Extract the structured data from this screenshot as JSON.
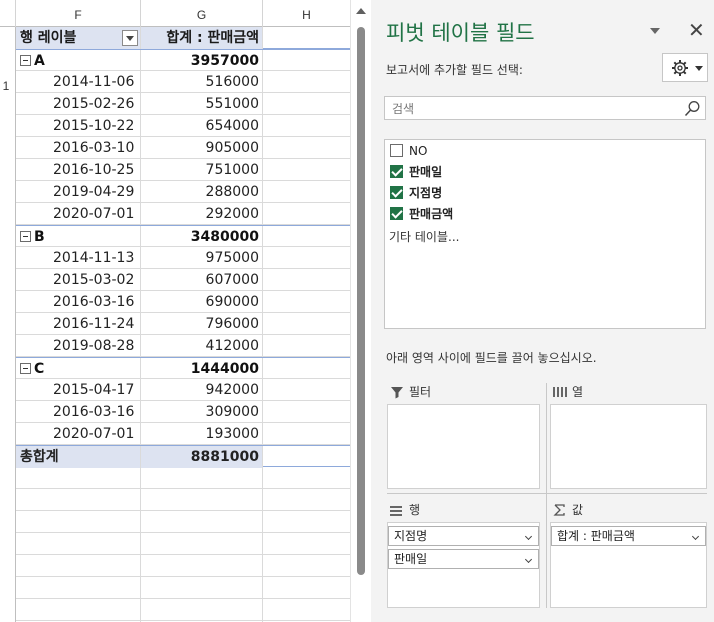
{
  "sheet": {
    "columns": [
      "F",
      "G",
      "H"
    ],
    "row_number": "1",
    "header": {
      "row_label": "행 레이블",
      "value_label": "합계 : 판매금액"
    },
    "groups": [
      {
        "name": "A",
        "total": "3957000",
        "items": [
          {
            "date": "2014-11-06",
            "value": "516000"
          },
          {
            "date": "2015-02-26",
            "value": "551000"
          },
          {
            "date": "2015-10-22",
            "value": "654000"
          },
          {
            "date": "2016-03-10",
            "value": "905000"
          },
          {
            "date": "2016-10-25",
            "value": "751000"
          },
          {
            "date": "2019-04-29",
            "value": "288000"
          },
          {
            "date": "2020-07-01",
            "value": "292000"
          }
        ]
      },
      {
        "name": "B",
        "total": "3480000",
        "items": [
          {
            "date": "2014-11-13",
            "value": "975000"
          },
          {
            "date": "2015-03-02",
            "value": "607000"
          },
          {
            "date": "2016-03-16",
            "value": "690000"
          },
          {
            "date": "2016-11-24",
            "value": "796000"
          },
          {
            "date": "2019-08-28",
            "value": "412000"
          }
        ]
      },
      {
        "name": "C",
        "total": "1444000",
        "items": [
          {
            "date": "2015-04-17",
            "value": "942000"
          },
          {
            "date": "2016-03-16",
            "value": "309000"
          },
          {
            "date": "2020-07-01",
            "value": "193000"
          }
        ]
      }
    ],
    "grand_total": {
      "label": "총합계",
      "value": "8881000"
    }
  },
  "pane": {
    "title": "피벗 테이블 필드",
    "close_glyph": "✕",
    "subtitle": "보고서에 추가할 필드 선택:",
    "search_placeholder": "검색",
    "fields": [
      {
        "label": "NO",
        "checked": false
      },
      {
        "label": "판매일",
        "checked": true
      },
      {
        "label": "지점명",
        "checked": true
      },
      {
        "label": "판매금액",
        "checked": true
      }
    ],
    "more_tables": "기타 테이블...",
    "hint": "아래 영역 사이에 필드를 끌어 놓으십시오.",
    "zones": {
      "filter": {
        "title": "필터"
      },
      "columns": {
        "title": "열"
      },
      "rows": {
        "title": "행",
        "chips": [
          "지점명",
          "판매일"
        ]
      },
      "values": {
        "title": "값",
        "chips": [
          "합계 : 판매금액"
        ]
      }
    },
    "accent_color": "#217346"
  }
}
